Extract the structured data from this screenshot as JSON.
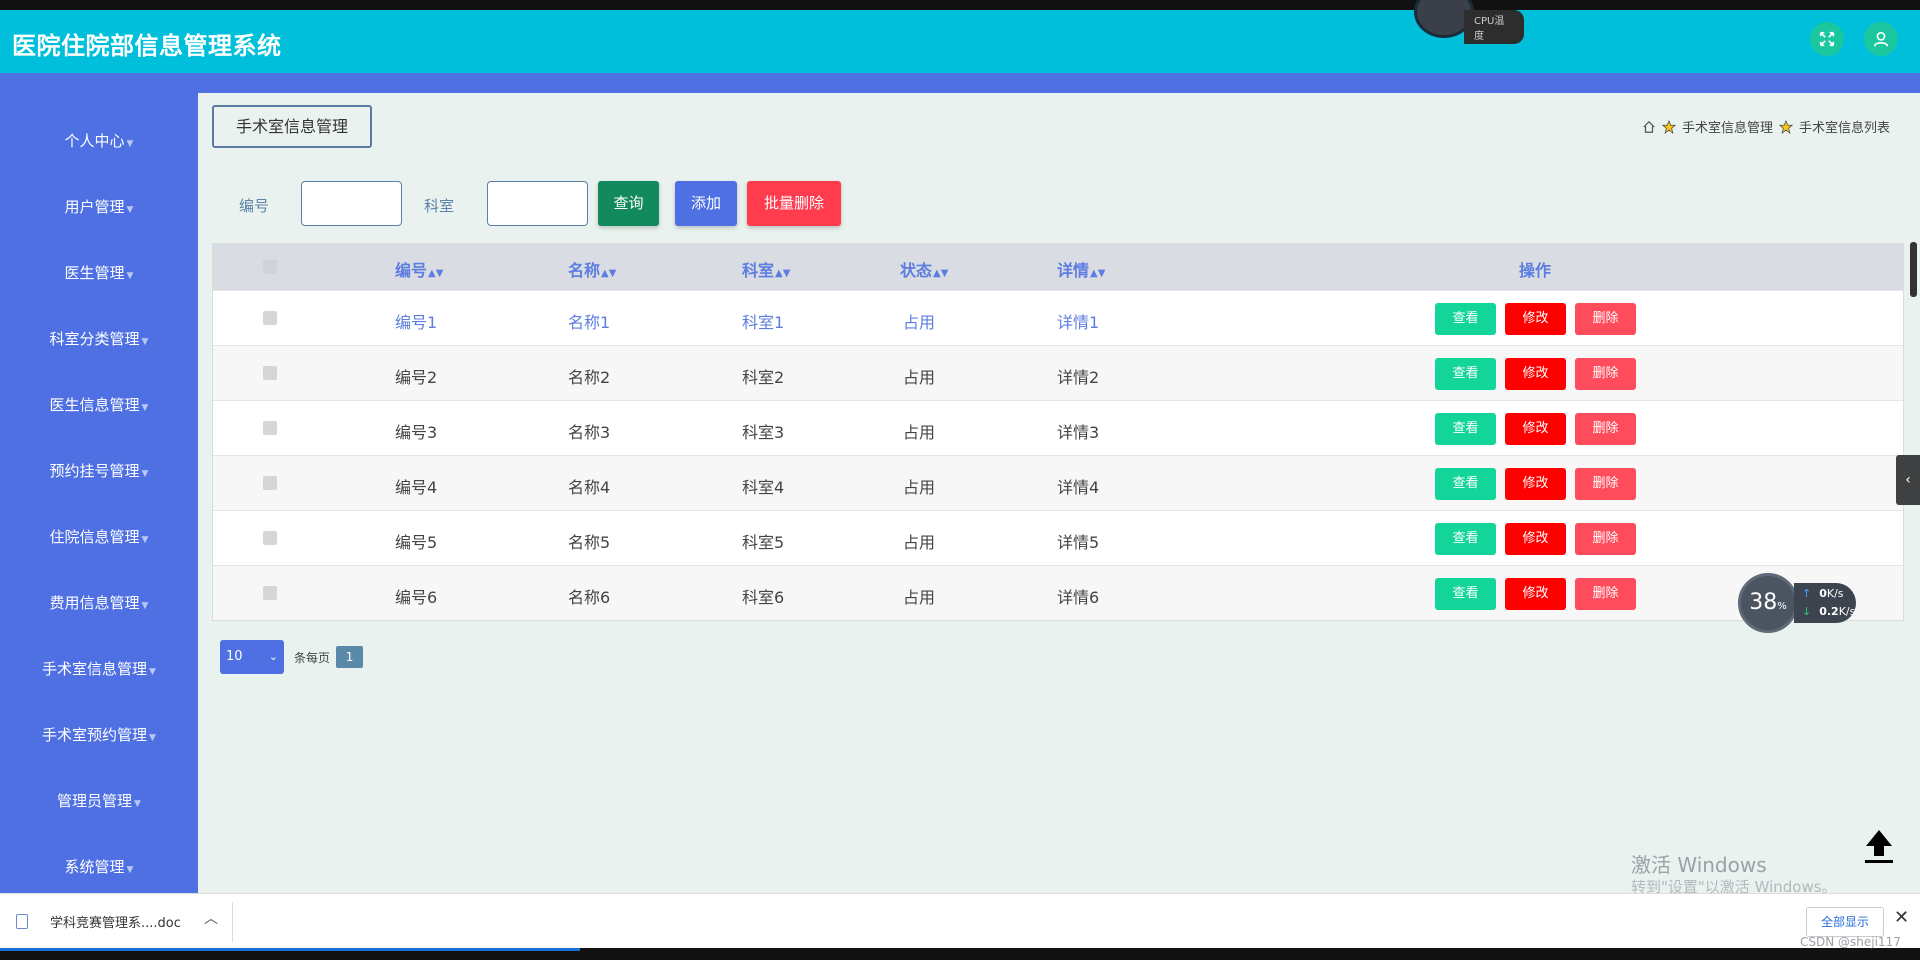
{
  "app_title": "医院住院部信息管理系统",
  "cpu_widget": "CPU温度",
  "sidebar": {
    "items": [
      {
        "label": "个人中心"
      },
      {
        "label": "用户管理"
      },
      {
        "label": "医生管理"
      },
      {
        "label": "科室分类管理"
      },
      {
        "label": "医生信息管理"
      },
      {
        "label": "预约挂号管理"
      },
      {
        "label": "住院信息管理"
      },
      {
        "label": "费用信息管理"
      },
      {
        "label": "手术室信息管理"
      },
      {
        "label": "手术室预约管理"
      },
      {
        "label": "管理员管理"
      },
      {
        "label": "系统管理"
      }
    ]
  },
  "page_title": "手术室信息管理",
  "breadcrumb": {
    "level1": "手术室信息管理",
    "level2": "手术室信息列表"
  },
  "search": {
    "label_number": "编号",
    "label_dept": "科室",
    "value_number": "",
    "value_dept": "",
    "query_button": "查询",
    "add_button": "添加",
    "batch_delete_button": "批量删除"
  },
  "table": {
    "headers": {
      "number": "编号",
      "name": "名称",
      "dept": "科室",
      "status": "状态",
      "details": "详情",
      "actions": "操作"
    },
    "action_labels": {
      "view": "查看",
      "edit": "修改",
      "delete": "删除"
    },
    "rows": [
      {
        "number": "编号1",
        "name": "名称1",
        "dept": "科室1",
        "status": "占用",
        "details": "详情1"
      },
      {
        "number": "编号2",
        "name": "名称2",
        "dept": "科室2",
        "status": "占用",
        "details": "详情2"
      },
      {
        "number": "编号3",
        "name": "名称3",
        "dept": "科室3",
        "status": "占用",
        "details": "详情3"
      },
      {
        "number": "编号4",
        "name": "名称4",
        "dept": "科室4",
        "status": "占用",
        "details": "详情4"
      },
      {
        "number": "编号5",
        "name": "名称5",
        "dept": "科室5",
        "status": "占用",
        "details": "详情5"
      },
      {
        "number": "编号6",
        "name": "名称6",
        "dept": "科室6",
        "status": "占用",
        "details": "详情6"
      }
    ]
  },
  "pager": {
    "page_size": "10",
    "per_page_label": "条每页",
    "current_page": "1"
  },
  "net_widget": {
    "percent": "38",
    "percent_unit": "%",
    "upload": "0",
    "upload_unit": "K/s",
    "download": "0.2",
    "download_unit": "K/s"
  },
  "watermark": {
    "title": "激活 Windows",
    "subtitle": "转到\"设置\"以激活 Windows。"
  },
  "download_bar": {
    "file_name": "学科竞赛管理系....doc",
    "show_all": "全部显示"
  },
  "csdn_mark": "CSDN @sheji117",
  "colors": {
    "header": "#00bfdb",
    "sidebar": "#4e70e2",
    "view_button": "#13d59a",
    "edit_button": "#ff0000",
    "delete_button": "#ff4c5c"
  }
}
